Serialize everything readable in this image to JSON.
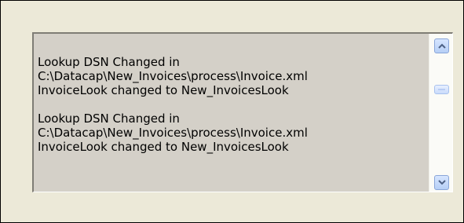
{
  "log": {
    "entries": [
      {
        "lines": [
          "Lookup DSN Changed in",
          "C:\\Datacap\\New_Invoices\\process\\Invoice.xml",
          "InvoiceLook changed to New_InvoicesLook"
        ]
      },
      {
        "lines": [
          "Lookup DSN Changed in",
          "C:\\Datacap\\New_Invoices\\process\\Invoice.xml",
          "InvoiceLook changed to New_InvoicesLook"
        ]
      }
    ]
  },
  "scrollbar": {
    "position_fraction": 0.32,
    "up_icon": "chevron-up-icon",
    "down_icon": "chevron-down-icon"
  },
  "colors": {
    "dialog_background": "#ece9d8",
    "log_background": "#d4d0c8",
    "scroll_button": "#b6cff6",
    "arrow": "#4d6185"
  }
}
